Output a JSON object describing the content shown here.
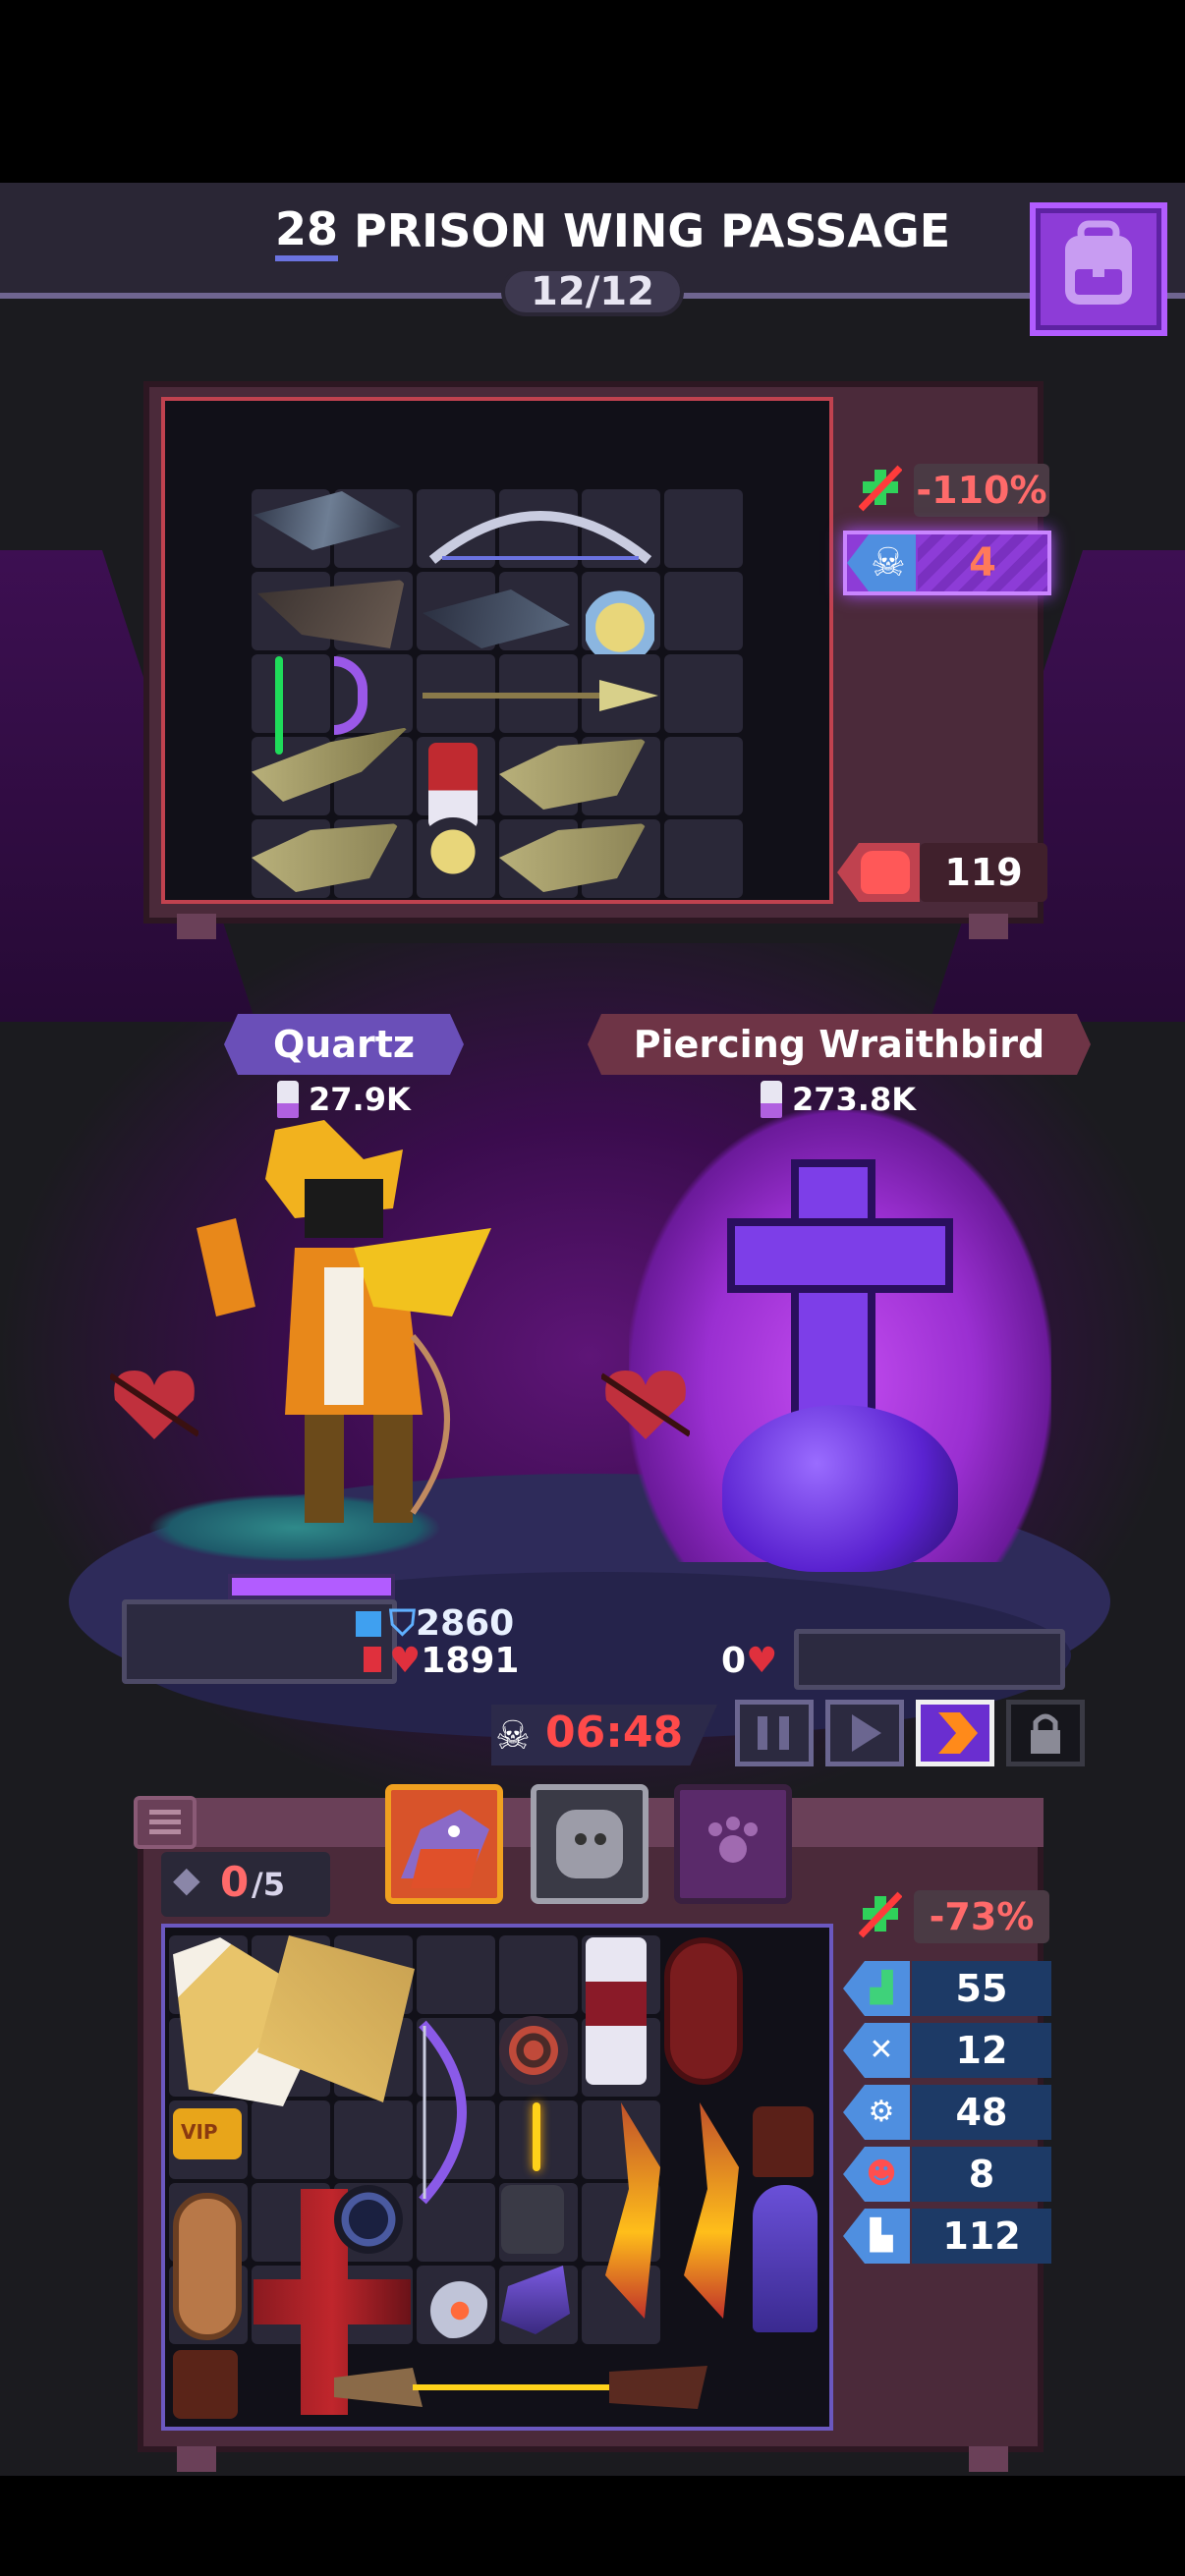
{
  "stage": {
    "number": "28",
    "title": "PRISON WING PASSAGE",
    "wave": "12/12"
  },
  "icons": {
    "inventory_button": "backpack-icon",
    "timer_skull": "skull-icon",
    "pause": "pause-icon",
    "play": "play-icon",
    "fast_forward": "fast-forward-icon",
    "lock": "lock-icon",
    "menu": "list-icon",
    "slot": "diamond-icon"
  },
  "enemy_loot": {
    "penalty": "-110%",
    "skull_count": "4",
    "treasure_value": "119"
  },
  "hero": {
    "name": "Quartz",
    "power": "27.9K",
    "shield": "2860",
    "hp": "1891"
  },
  "boss": {
    "name": "Piercing Wraithbird",
    "power": "273.8K",
    "hp": "0"
  },
  "battle": {
    "timer": "06:48",
    "speed_selected": "fast-forward"
  },
  "inventory": {
    "slots_used": "0",
    "slots_max": "/5",
    "penalty": "-73%",
    "stats": [
      {
        "icon": "stairs-icon",
        "value": "55",
        "color": "#3fd27a"
      },
      {
        "icon": "crossed-bones-icon",
        "value": "12",
        "color": "#ffffff"
      },
      {
        "icon": "gear-eye-icon",
        "value": "48",
        "color": "#ffffff"
      },
      {
        "icon": "demon-face-icon",
        "value": "8",
        "color": "#ff4f4f"
      },
      {
        "icon": "boot-icon",
        "value": "112",
        "color": "#ffffff"
      }
    ]
  },
  "colors": {
    "accent_purple": "#8d3cd7",
    "danger_red": "#ff4a4a",
    "stat_blue": "#4f8fe0"
  }
}
